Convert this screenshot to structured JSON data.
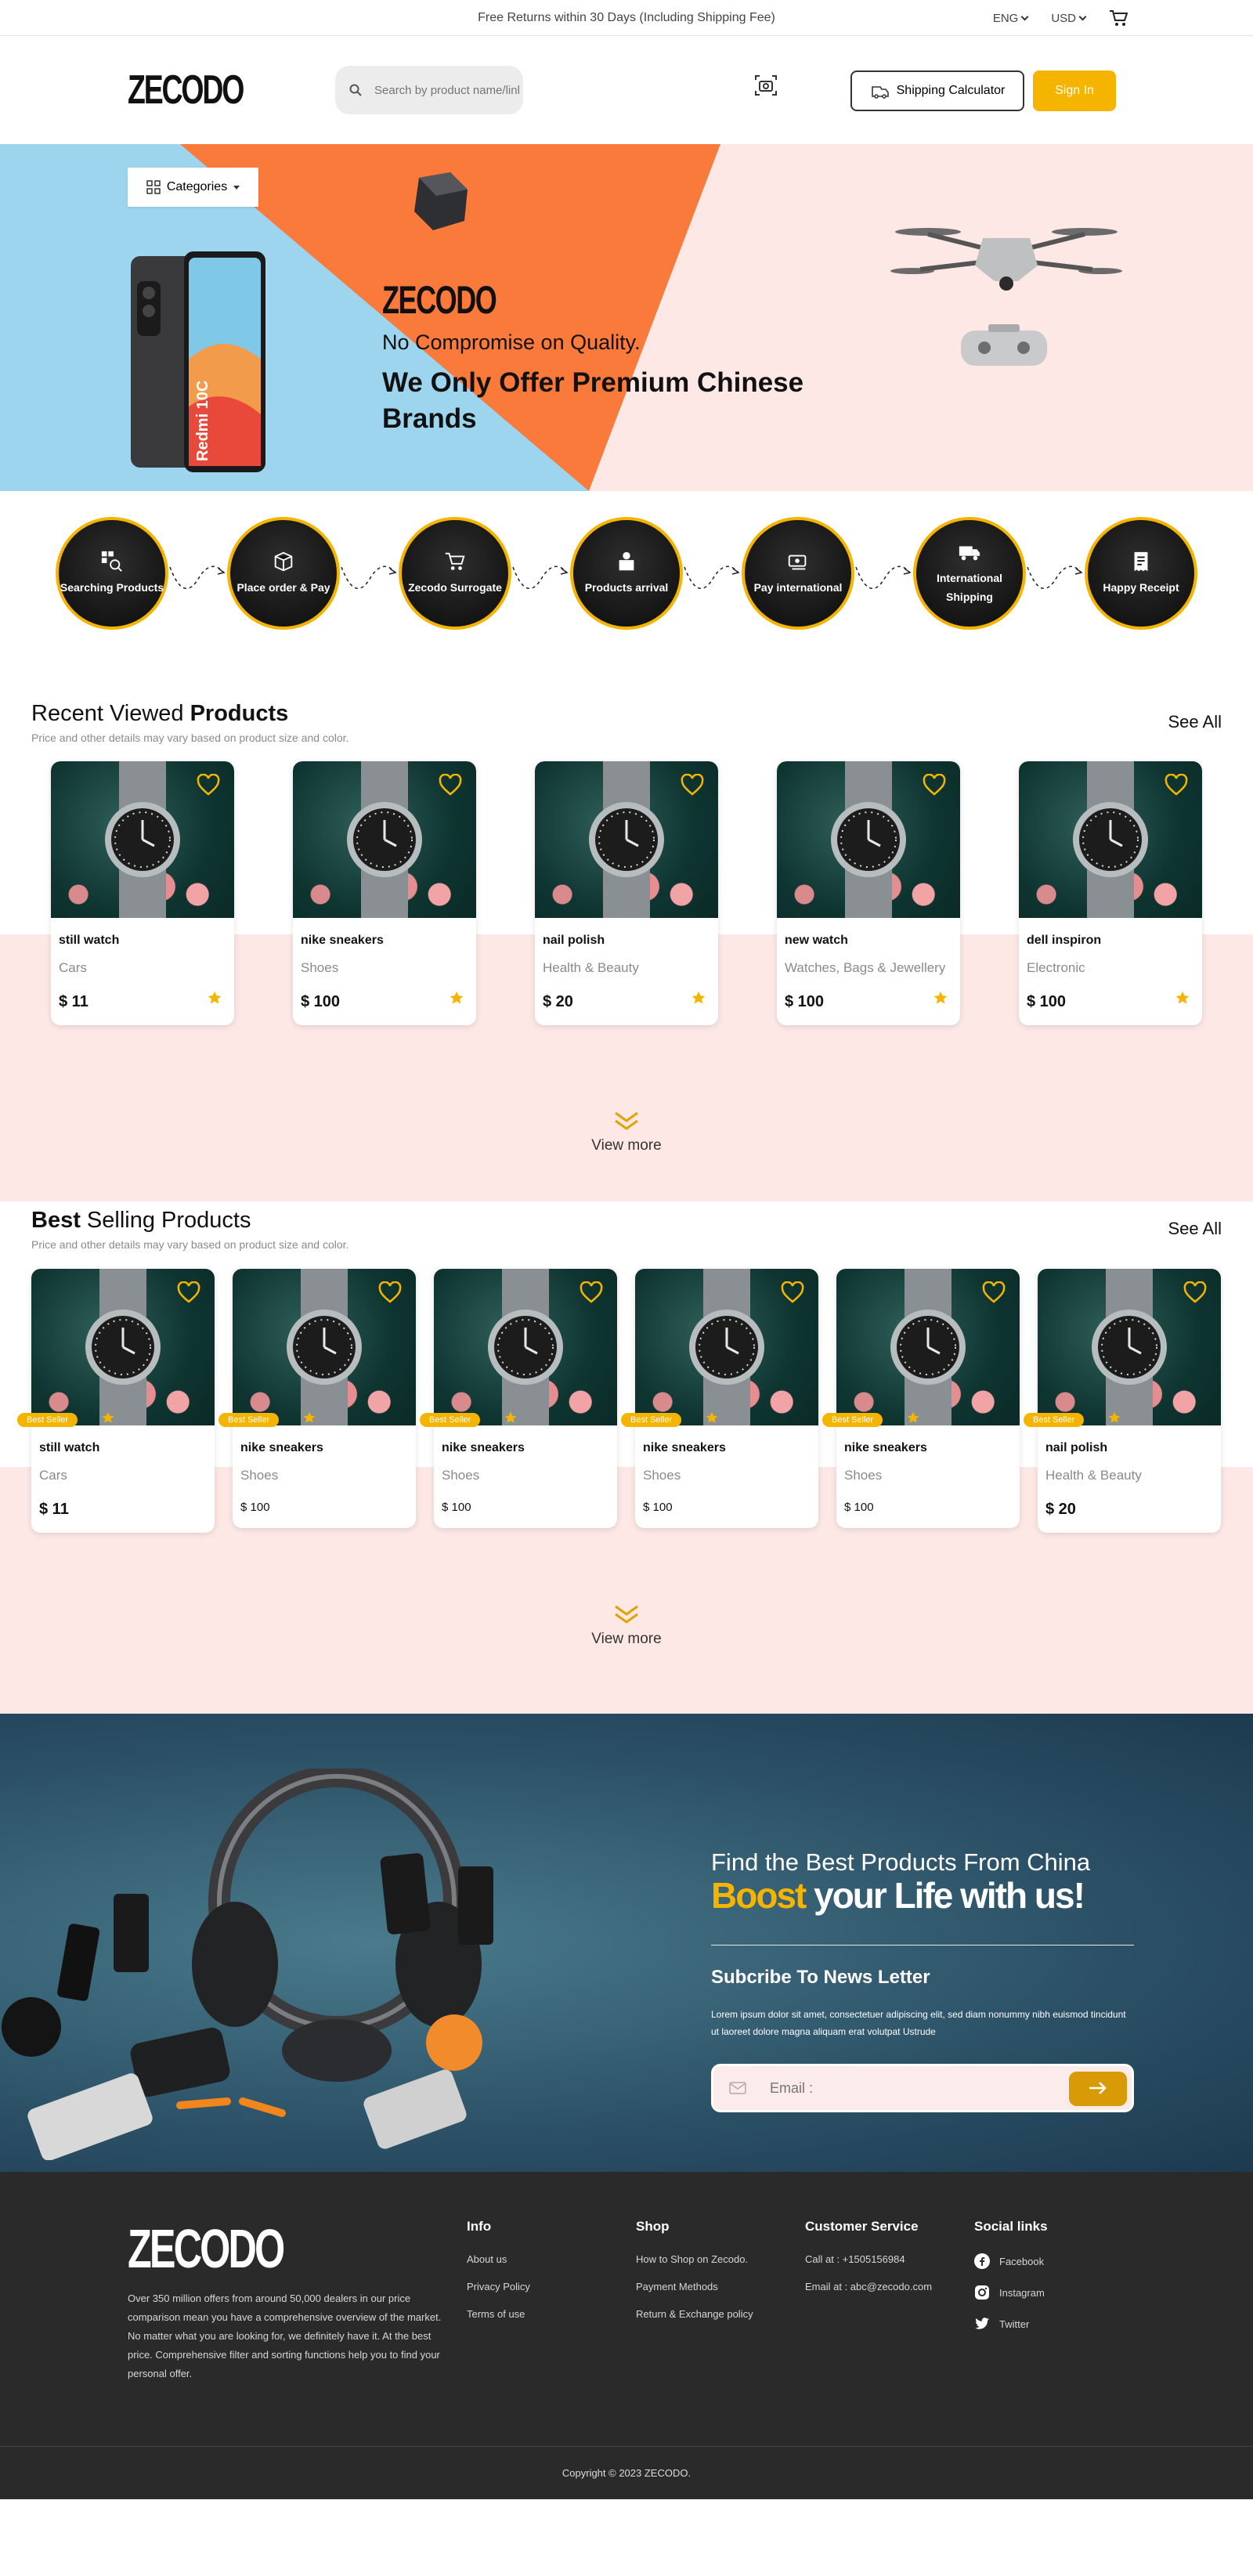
{
  "topbar": {
    "announcement": "Free Returns within 30 Days (Including Shipping Fee)",
    "language": "ENG",
    "currency": "USD"
  },
  "header": {
    "logo": "ZECODO",
    "search_placeholder": "Search by product name/link...",
    "shipping_calculator": "Shipping Calculator",
    "sign_in": "Sign In"
  },
  "hero": {
    "categories": "Categories",
    "brand": "ZECODO",
    "tagline": "No Compromise on Quality.",
    "title": "We Only Offer Premium Chinese Brands"
  },
  "steps": [
    {
      "label": "Searching Products",
      "icon": "search-products-icon"
    },
    {
      "label": "Place order & Pay",
      "icon": "box-icon"
    },
    {
      "label": "Zecodo Surrogate",
      "icon": "cart-icon"
    },
    {
      "label": "Products arrival",
      "icon": "package-icon"
    },
    {
      "label": "Pay international",
      "icon": "cash-icon"
    },
    {
      "label": "International Shipping",
      "icon": "truck-icon"
    },
    {
      "label": "Happy Receipt",
      "icon": "receipt-icon"
    }
  ],
  "recent": {
    "title_a": "Recent Viewed ",
    "title_b": "Products",
    "subtitle": "Price and other details may vary based on product size and color.",
    "see_all": "See All",
    "view_more": "View more",
    "items": [
      {
        "name": "still watch",
        "category": "Cars",
        "price": "$ 11"
      },
      {
        "name": "nike sneakers",
        "category": "Shoes",
        "price": "$ 100"
      },
      {
        "name": "nail polish",
        "category": "Health & Beauty",
        "price": "$ 20"
      },
      {
        "name": "new watch",
        "category": "Watches, Bags & Jewellery",
        "price": "$ 100"
      },
      {
        "name": "dell inspiron",
        "category": "Electronic",
        "price": "$ 100"
      }
    ]
  },
  "best": {
    "title_a": "Best",
    "title_b": " Selling Products",
    "subtitle": "Price and other details may vary based on product size and color.",
    "see_all": "See All",
    "view_more": "View more",
    "badge": "Best Seller",
    "items": [
      {
        "name": "still watch",
        "category": "Cars",
        "price": "$ 11"
      },
      {
        "name": "nike sneakers",
        "category": "Shoes",
        "price": "$ 100"
      },
      {
        "name": "nike sneakers",
        "category": "Shoes",
        "price": "$ 100"
      },
      {
        "name": "nike sneakers",
        "category": "Shoes",
        "price": "$ 100"
      },
      {
        "name": "nike sneakers",
        "category": "Shoes",
        "price": "$ 100"
      },
      {
        "name": "nail polish",
        "category": "Health & Beauty",
        "price": "$ 20"
      }
    ]
  },
  "newsletter": {
    "line1": "Find the Best Products From China",
    "boost": "Boost",
    "line2_rest": " your Life with us!",
    "subscribe_title": "Subcribe To News Letter",
    "subscribe_desc": "Lorem ipsum dolor sit amet, consectetuer adipiscing elit, sed diam nonummy nibh euismod tincidunt ut laoreet dolore magna aliquam erat volutpat Ustrude",
    "email_placeholder": "Email :"
  },
  "footer": {
    "logo": "ZECODO",
    "description": "Over 350 million offers from around 50,000 dealers in our price comparison mean you have a comprehensive overview of the market. No matter what you are looking for, we definitely have it. At the best price. Comprehensive filter and sorting functions help you to find your personal offer.",
    "info": {
      "title": "Info",
      "links": [
        "About us",
        "Privacy Policy",
        "Terms of use"
      ]
    },
    "shop": {
      "title": "Shop",
      "links": [
        "How to Shop on Zecodo.",
        "Payment Methods",
        "Return & Exchange policy"
      ]
    },
    "service": {
      "title": "Customer Service",
      "links": [
        "Call at : +1505156984",
        "Email at : abc@zecodo.com"
      ]
    },
    "social": {
      "title": "Social links",
      "links": [
        "Facebook",
        "Instagram",
        "Twitter"
      ]
    },
    "copyright": "Copyright © 2023 ZECODO."
  },
  "colors": {
    "accent": "#f5b400",
    "hero_blue": "#9dd4ee",
    "hero_orange": "#fa7a3c",
    "pink": "#fde8e6",
    "footer": "#2a2a2a"
  }
}
